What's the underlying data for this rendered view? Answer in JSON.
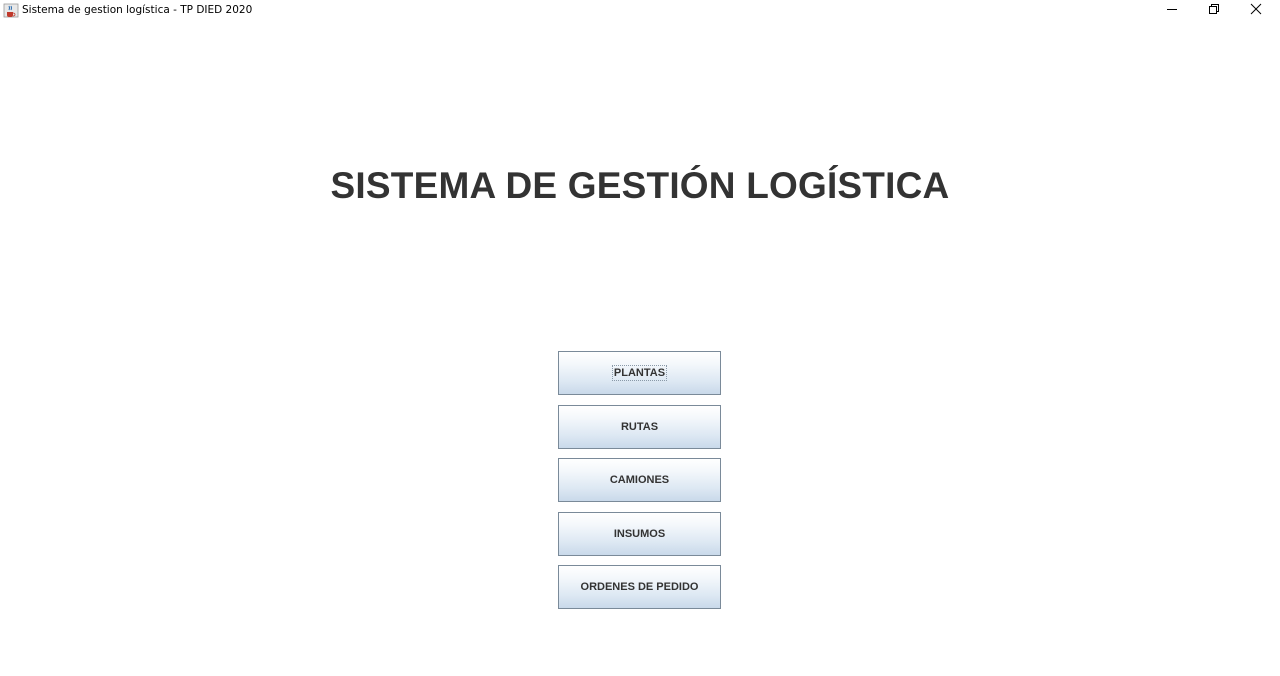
{
  "window": {
    "title": "Sistema de gestion logística - TP DIED 2020",
    "app_icon": "java-coffee-icon",
    "controls": {
      "minimize_icon": "minimize-icon",
      "restore_icon": "restore-icon",
      "close_icon": "close-icon"
    }
  },
  "main": {
    "heading": "SISTEMA DE GESTIÓN LOGÍSTICA",
    "buttons": [
      {
        "label": "PLANTAS",
        "focused": true
      },
      {
        "label": "RUTAS",
        "focused": false
      },
      {
        "label": "CAMIONES",
        "focused": false
      },
      {
        "label": "INSUMOS",
        "focused": false
      },
      {
        "label": "ORDENES DE PEDIDO",
        "focused": false
      }
    ]
  },
  "colors": {
    "heading_text": "#333333",
    "button_border": "#7a8a99",
    "button_gradient_bottom": "#c9d9ea"
  }
}
